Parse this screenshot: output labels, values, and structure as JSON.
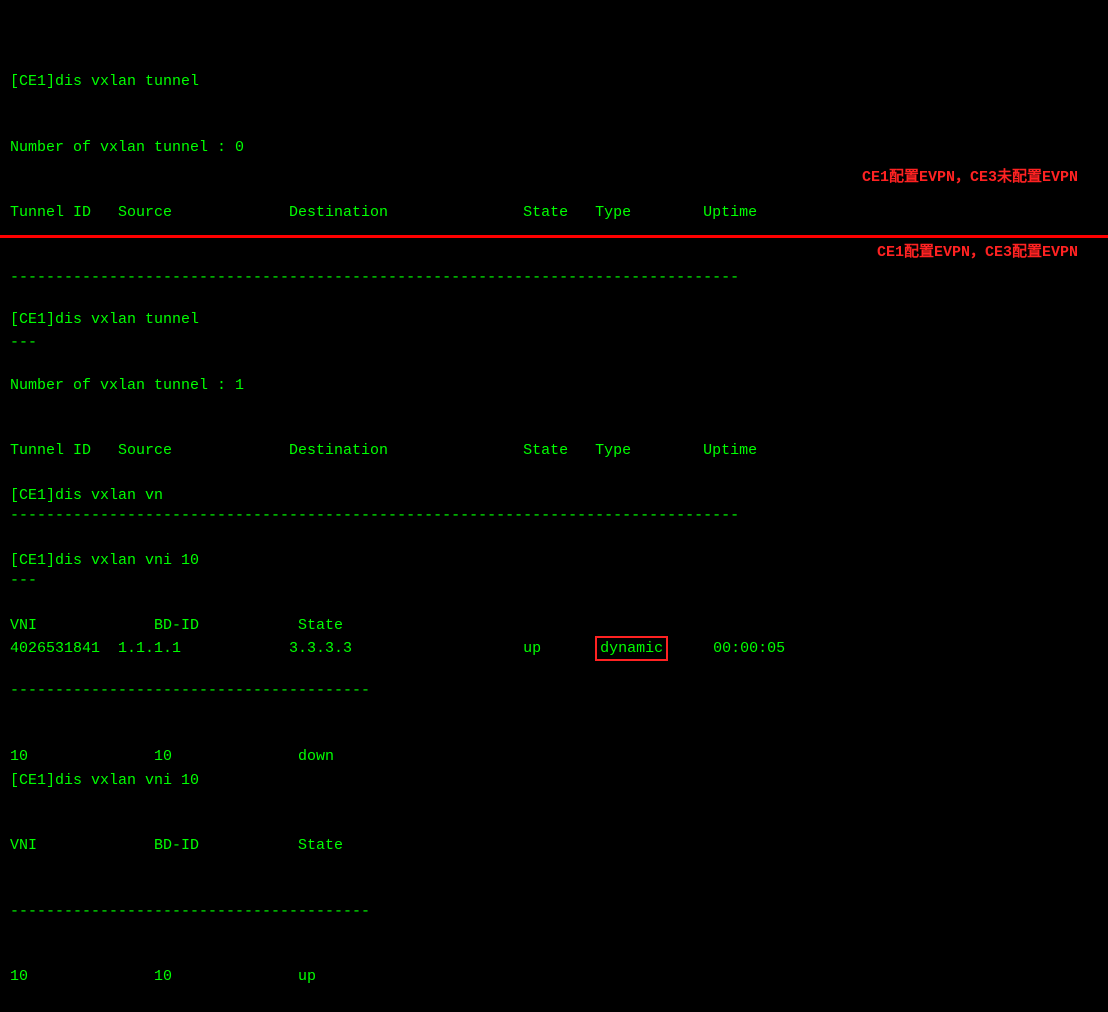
{
  "terminal": {
    "lines": [
      {
        "id": "l1",
        "text": "[CE1]dis vxlan tunnel"
      },
      {
        "id": "l2",
        "text": "Number of vxlan tunnel : 0"
      },
      {
        "id": "l3",
        "text": "Tunnel ID   Source             Destination               State   Type        Uptime"
      },
      {
        "id": "l4",
        "text": "---------------------------------------------------------------------------------"
      },
      {
        "id": "l5",
        "text": "---"
      },
      {
        "id": "l6",
        "text": ""
      },
      {
        "id": "l7",
        "text": "[CE1]dis vxlan vn"
      },
      {
        "id": "l8",
        "text": "[CE1]dis vxlan vni 10"
      },
      {
        "id": "l9",
        "text": "VNI             BD-ID           State"
      },
      {
        "id": "l10",
        "text": "----------------------------------------"
      },
      {
        "id": "l11",
        "text": "10              10              down"
      },
      {
        "id": "l12_divider",
        "text": ""
      },
      {
        "id": "l13",
        "text": "[CE1]dis vxlan tunnel"
      },
      {
        "id": "l14",
        "text": "Number of vxlan tunnel : 1"
      },
      {
        "id": "l15",
        "text": "Tunnel ID   Source             Destination               State   Type        Uptime"
      },
      {
        "id": "l16",
        "text": "---------------------------------------------------------------------------------"
      },
      {
        "id": "l17",
        "text": "---"
      },
      {
        "id": "l18",
        "text": "4026531841  1.1.1.1            3.3.3.3                   up      dynamic     00:00:05"
      },
      {
        "id": "l19",
        "text": ""
      },
      {
        "id": "l20",
        "text": "[CE1]dis vxlan vni 10"
      },
      {
        "id": "l21",
        "text": "VNI             BD-ID           State"
      },
      {
        "id": "l22",
        "text": "----------------------------------------"
      },
      {
        "id": "l23",
        "text": "10              10              up"
      }
    ],
    "annotations": {
      "top": "CE1配置EVPN，CE3未配置EVPN",
      "bottom": "CE1配置EVPN，CE3配置EVPN"
    }
  }
}
